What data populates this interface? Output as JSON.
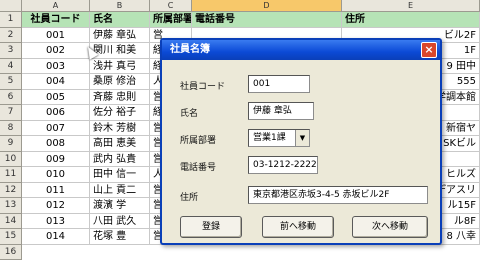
{
  "spreadsheet": {
    "columns": [
      "A",
      "B",
      "C",
      "D",
      "E"
    ],
    "rows": [
      "1",
      "2",
      "3",
      "4",
      "5",
      "6",
      "7",
      "8",
      "9",
      "10",
      "11",
      "12",
      "13",
      "14",
      "15",
      "16"
    ],
    "headers": {
      "a": "社員コード",
      "b": "氏名",
      "c": "所属部署",
      "d": "電話番号",
      "e": "住所"
    },
    "data": [
      {
        "a": "001",
        "b": "伊藤 章弘",
        "c": "営",
        "d": "",
        "e": "ビル2F"
      },
      {
        "a": "002",
        "b": "関川 和美",
        "c": "経",
        "d": "",
        "e": "1F"
      },
      {
        "a": "003",
        "b": "浅井 真弓",
        "c": "経",
        "d": "",
        "e": "9 田中"
      },
      {
        "a": "004",
        "b": "桑原 修治",
        "c": "人",
        "d": "",
        "e": "555"
      },
      {
        "a": "005",
        "b": "斉藤 忠則",
        "c": "営",
        "d": "",
        "e": "学調本館"
      },
      {
        "a": "006",
        "b": "佐分 裕子",
        "c": "経",
        "d": "",
        "e": ""
      },
      {
        "a": "007",
        "b": "鈴木 芳樹",
        "c": "営",
        "d": "",
        "e": "新宿ヤ"
      },
      {
        "a": "008",
        "b": "高田 恵美",
        "c": "営",
        "d": "",
        "e": "SKビル"
      },
      {
        "a": "009",
        "b": "武内 弘貴",
        "c": "営",
        "d": "",
        "e": ""
      },
      {
        "a": "010",
        "b": "田中 信一",
        "c": "人",
        "d": "",
        "e": "ヒルズ"
      },
      {
        "a": "011",
        "b": "山上 貢二",
        "c": "営",
        "d": "",
        "e": "デアスリ"
      },
      {
        "a": "012",
        "b": "渡濱 学",
        "c": "営",
        "d": "",
        "e": "ル15F"
      },
      {
        "a": "013",
        "b": "八田 武久",
        "c": "営",
        "d": "",
        "e": "ル8F"
      },
      {
        "a": "014",
        "b": "花塚 豊",
        "c": "営",
        "d": "",
        "e": "8 八幸"
      }
    ]
  },
  "dialog": {
    "title": "社員名簿",
    "close_label": "×",
    "labels": {
      "code": "社員コード",
      "name": "氏名",
      "dept": "所属部署",
      "phone": "電話番号",
      "address": "住所"
    },
    "values": {
      "code": "001",
      "name": "伊藤 章弘",
      "dept": "営業1課",
      "phone": "03-1212-2222",
      "address": "東京都港区赤坂3-4-5 赤坂ビル2F"
    },
    "buttons": {
      "register": "登録",
      "prev": "前へ移動",
      "next": "次へ移動"
    }
  },
  "icons": {
    "combo_arrow": "chevron-down-icon",
    "close": "close-icon"
  }
}
